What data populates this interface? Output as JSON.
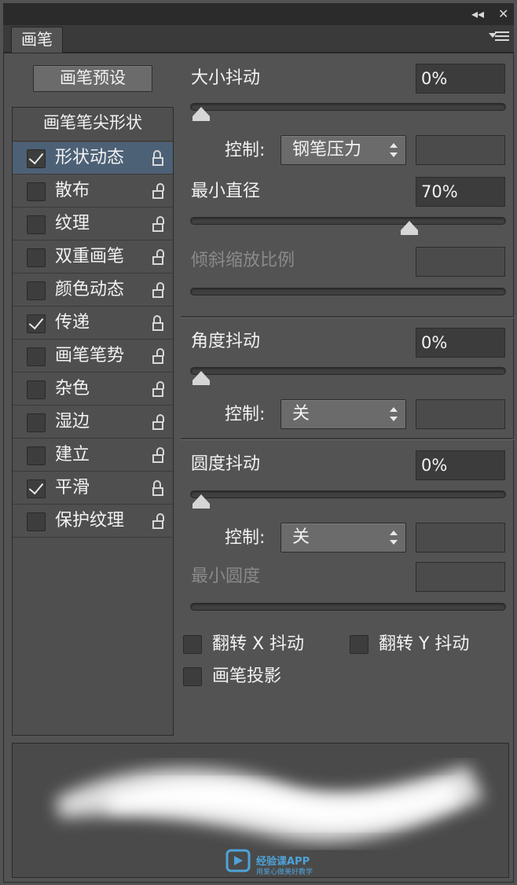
{
  "panel": {
    "tab_title": "画笔",
    "collapse_glyph": "◂◂",
    "close_glyph": "✕"
  },
  "preset_button": "画笔预设",
  "tip_shape_label": "画笔笔尖形状",
  "options": [
    {
      "label": "形状动态",
      "checked": true,
      "selected": true,
      "lock": "closed"
    },
    {
      "label": "散布",
      "checked": false,
      "selected": false,
      "lock": "open"
    },
    {
      "label": "纹理",
      "checked": false,
      "selected": false,
      "lock": "open"
    },
    {
      "label": "双重画笔",
      "checked": false,
      "selected": false,
      "lock": "open"
    },
    {
      "label": "颜色动态",
      "checked": false,
      "selected": false,
      "lock": "open"
    },
    {
      "label": "传递",
      "checked": true,
      "selected": false,
      "lock": "closed"
    },
    {
      "label": "画笔笔势",
      "checked": false,
      "selected": false,
      "lock": "open"
    },
    {
      "label": "杂色",
      "checked": false,
      "selected": false,
      "lock": "open"
    },
    {
      "label": "湿边",
      "checked": false,
      "selected": false,
      "lock": "open"
    },
    {
      "label": "建立",
      "checked": false,
      "selected": false,
      "lock": "open"
    },
    {
      "label": "平滑",
      "checked": true,
      "selected": false,
      "lock": "closed"
    },
    {
      "label": "保护纹理",
      "checked": false,
      "selected": false,
      "lock": "open"
    }
  ],
  "size_jitter": {
    "label": "大小抖动",
    "value": "0%",
    "level": 0
  },
  "control1": {
    "label": "控制:",
    "value": "钢笔压力"
  },
  "min_diameter": {
    "label": "最小直径",
    "value": "70%",
    "level": 0.7
  },
  "tilt_scale": {
    "label": "倾斜缩放比例",
    "value": ""
  },
  "angle_jitter": {
    "label": "角度抖动",
    "value": "0%",
    "level": 0
  },
  "control2": {
    "label": "控制:",
    "value": "关"
  },
  "roundness_jitter": {
    "label": "圆度抖动",
    "value": "0%",
    "level": 0
  },
  "control3": {
    "label": "控制:",
    "value": "关"
  },
  "min_roundness": {
    "label": "最小圆度",
    "value": ""
  },
  "flip_x": {
    "label": "翻转 X 抖动",
    "checked": false
  },
  "flip_y": {
    "label": "翻转 Y 抖动",
    "checked": false
  },
  "brush_projection": {
    "label": "画笔投影",
    "checked": false
  },
  "watermark": {
    "title": "经验课APP",
    "subtitle": "用爱心做美好教学"
  },
  "colors": {
    "panel_bg": "#535353",
    "selected_row": "#4d6176",
    "input_bg": "#3c3c3c"
  }
}
